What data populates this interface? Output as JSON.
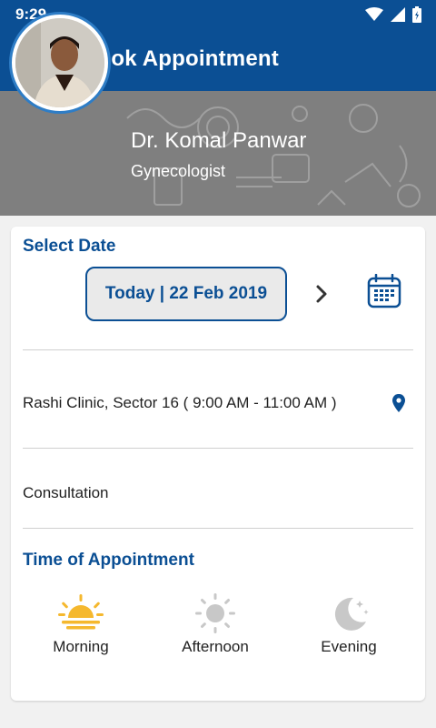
{
  "status_bar": {
    "time": "9:29"
  },
  "app_bar": {
    "title": "Book Appointment"
  },
  "doctor": {
    "name": "Dr. Komal Panwar",
    "specialty": "Gynecologist"
  },
  "select_date": {
    "heading": "Select Date",
    "date_text": "Today | 22 Feb 2019"
  },
  "clinic": {
    "text": "Rashi Clinic, Sector 16 ( 9:00 AM - 11:00 AM )"
  },
  "appointment_type": {
    "text": "Consultation"
  },
  "time_of_appointment": {
    "heading": "Time of Appointment",
    "slots": [
      {
        "label": "Morning",
        "active": true
      },
      {
        "label": "Afternoon",
        "active": false
      },
      {
        "label": "Evening",
        "active": false
      }
    ]
  },
  "colors": {
    "primary": "#0b4f94",
    "sun_active": "#f5b82e",
    "inactive_icon": "#c8c8c8"
  }
}
